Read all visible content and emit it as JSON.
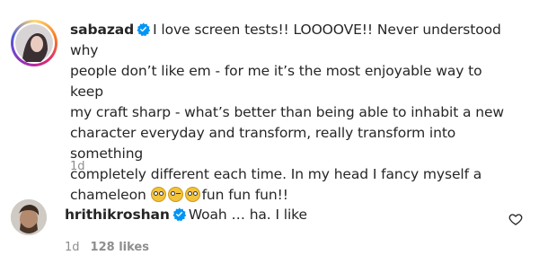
{
  "comments": [
    {
      "username": "sabazad",
      "verified": true,
      "text_lines": [
        "I love screen tests!! LOOOOVE!! Never understood why",
        "people don’t like em - for me it’s the most enjoyable way to keep",
        "my craft sharp - what’s better than being able to inhabit a new",
        "character everyday and transform, really transform into something",
        "completely different each time. In my head I fancy myself a",
        "chameleon"
      ],
      "text_tail": "fun fun fun!!",
      "emojis": [
        "flushed-face",
        "squinting-face",
        "flushed-face"
      ],
      "time": "1d"
    },
    {
      "username": "hrithikroshan",
      "verified": true,
      "text": "Woah … ha. I like",
      "time": "1d",
      "likes": "128 likes",
      "like_icon": "heart-outline-icon"
    }
  ],
  "colors": {
    "text": "#262626",
    "meta": "#8e8e8e",
    "verified": "#0095f6"
  }
}
